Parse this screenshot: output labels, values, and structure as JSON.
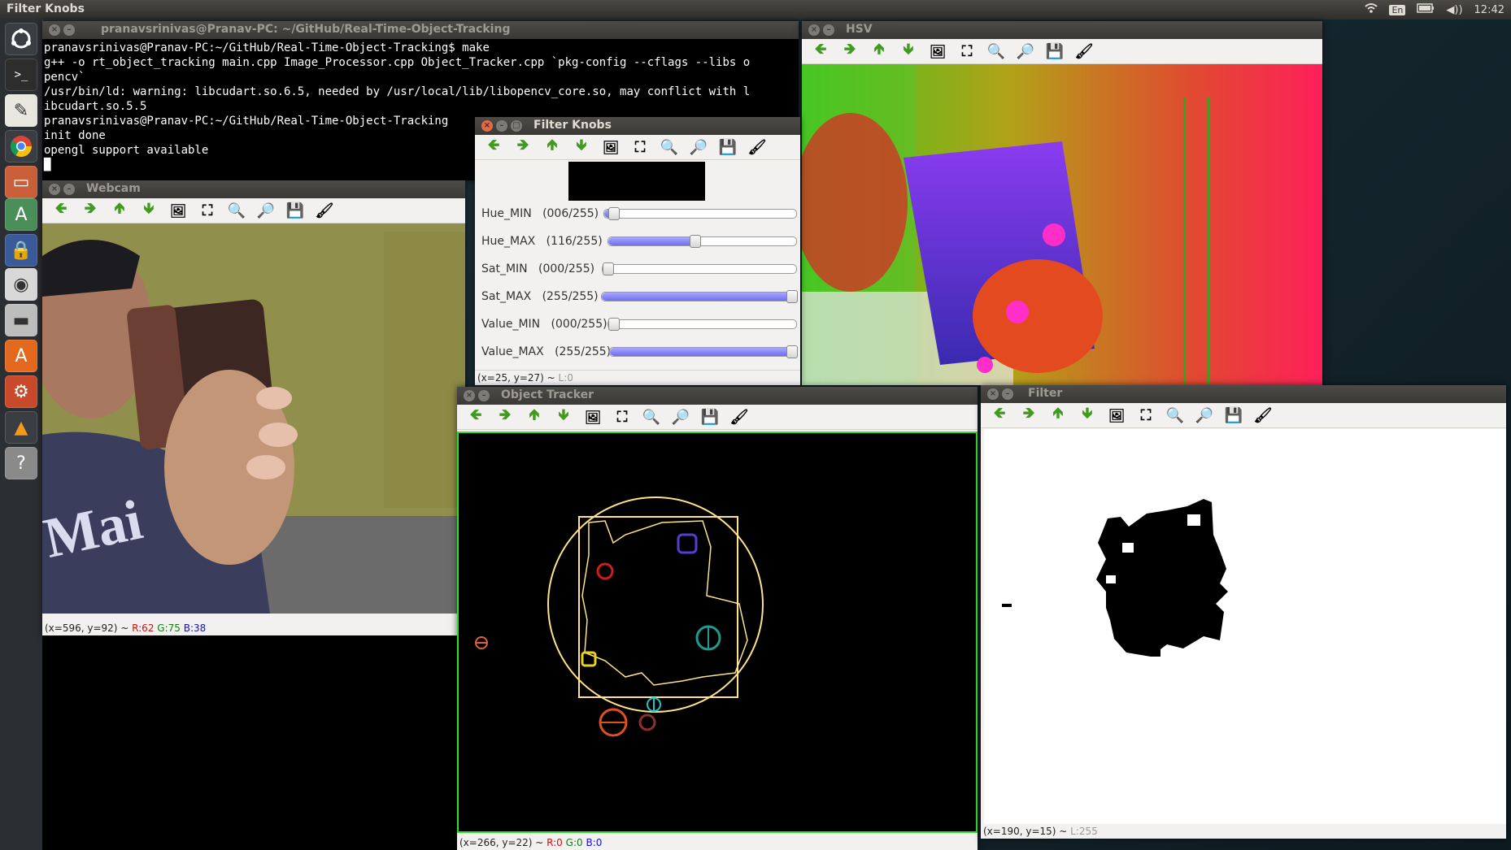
{
  "top_panel": {
    "app_name": "Filter Knobs",
    "lang": "En",
    "volume": "◀))",
    "time": "12:42"
  },
  "launcher": {
    "items": [
      "dash-icon",
      "terminal-icon",
      "text-editor-icon",
      "chrome-icon",
      "files-icon",
      "software-updater-icon",
      "lock-icon",
      "webcam-icon",
      "drive-icon",
      "software-center-icon",
      "settings-icon",
      "vlc-icon",
      "help-icon"
    ]
  },
  "terminal": {
    "title": "pranavsrinivas@Pranav-PC: ~/GitHub/Real-Time-Object-Tracking",
    "lines": [
      "pranavsrinivas@Pranav-PC:~/GitHub/Real-Time-Object-Tracking$ make",
      "g++ -o rt_object_tracking main.cpp Image_Processor.cpp Object_Tracker.cpp `pkg-config --cflags --libs o",
      "pencv`",
      "/usr/bin/ld: warning: libcudart.so.6.5, needed by /usr/local/lib/libopencv_core.so, may conflict with l",
      "ibcudart.so.5.5",
      "pranavsrinivas@Pranav-PC:~/GitHub/Real-Time-Object-Tracking",
      "init done",
      "opengl support available",
      "█"
    ]
  },
  "webcam": {
    "title": "Webcam",
    "status_prefix": "(x=596, y=92) ~ ",
    "r": "R:62",
    "g": "G:75",
    "b": "B:38"
  },
  "filter_knobs": {
    "title": "Filter Knobs",
    "sliders": [
      {
        "label": "Hue_MIN",
        "value": "(006/255)",
        "level": 0.024
      },
      {
        "label": "Hue_MAX",
        "value": "(116/255)",
        "level": 0.455
      },
      {
        "label": "Sat_MIN",
        "value": "(000/255)",
        "level": 0.0
      },
      {
        "label": "Sat_MAX",
        "value": "(255/255)",
        "level": 1.0
      },
      {
        "label": "Value_MIN",
        "value": "(000/255)",
        "level": 0.0
      },
      {
        "label": "Value_MAX",
        "value": "(255/255)",
        "level": 1.0
      }
    ],
    "status_prefix": "(x=25, y=27) ~ ",
    "status_l": "L:0"
  },
  "hsv": {
    "title": "HSV"
  },
  "object_tracker": {
    "title": "Object Tracker",
    "status_prefix": "(x=266, y=22) ~ ",
    "r": "R:0",
    "g": "G:0",
    "b": "B:0"
  },
  "filter": {
    "title": "Filter",
    "status_prefix": "(x=190, y=15) ~ ",
    "status_l": "L:255"
  },
  "colors": {
    "accent_green": "#3f9b1e",
    "close_orange": "#e0694a",
    "slider_fill": "#7b7bf2",
    "tracker_border": "#2ee02e",
    "tracker_yellow": "#ffe38a"
  }
}
